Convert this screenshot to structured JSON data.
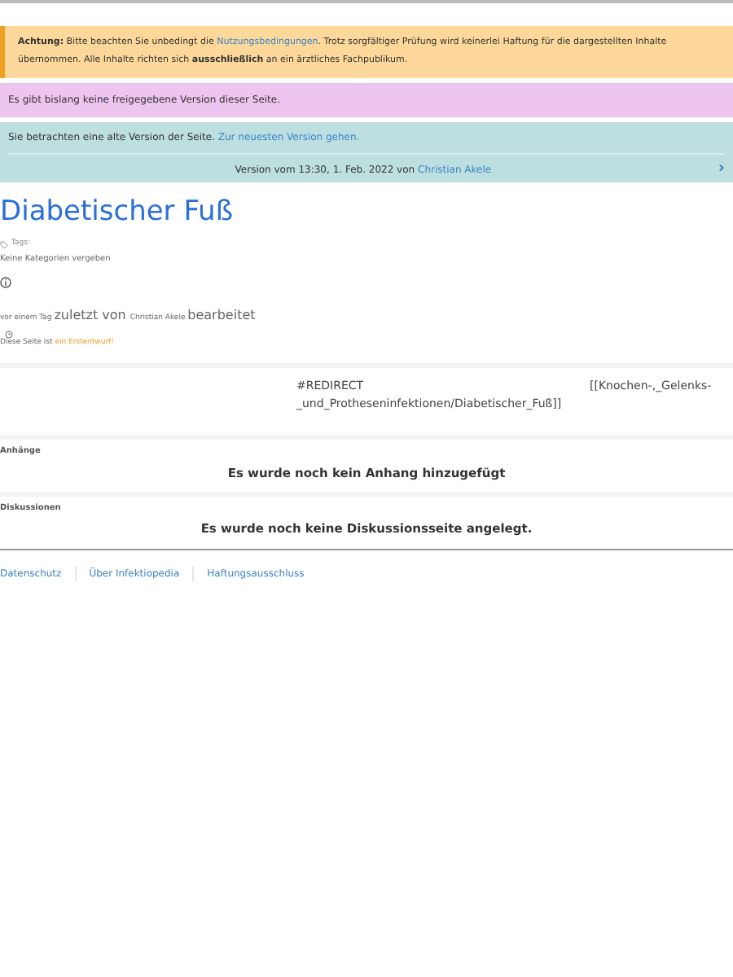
{
  "notice": {
    "label": "Achtung:",
    "link": "Nutzungsbedingungen",
    "before": "Bitte beachten Sie unbedingt die",
    "after": ". Trotz sorgfältiger Prüfung wird keinerlei Haftung für die dargestellten Inhalte übernommen. Alle Inhalte richten sich **ausschließlich** an ein ärztliches Fachpublikum."
  },
  "no_release": "Es gibt bislang keine freigegebene Version dieser Seite.",
  "old_version": {
    "text": "Sie betrachten eine alte Version der Seite.",
    "link": "Zur neuesten Version gehen.",
    "version": "Version vom 13:30, 1. Feb. 2022 von",
    "author": "Christian Akele",
    "next": "›"
  },
  "title": "Diabetischer Fuß",
  "tags_label": "Tags:",
  "categories": "Keine Kategorien vergeben",
  "edited": {
    "when": "vor einem Tag",
    "mid": "zuletzt von",
    "author": "Christian Akele",
    "end": "bearbeitet"
  },
  "draft": {
    "text": "Diese Seite ist",
    "link": "ein Erstentwurf!"
  },
  "redirect": {
    "column_1": "#REDIRECT _und_Protheseninfektionen/Diabetischer_Fuß]]",
    "column_2": "[[Knochen-,_Gelenks-"
  },
  "sections": [
    {
      "title": "Anhänge",
      "message": "Es wurde noch kein Anhang hinzugefügt"
    },
    {
      "title": "Diskussionen",
      "message": "Es wurde noch keine Diskussionsseite angelegt."
    }
  ],
  "footer_links": [
    "Datenschutz",
    "Über Infektiopedia",
    "Haftungsausschluss"
  ]
}
